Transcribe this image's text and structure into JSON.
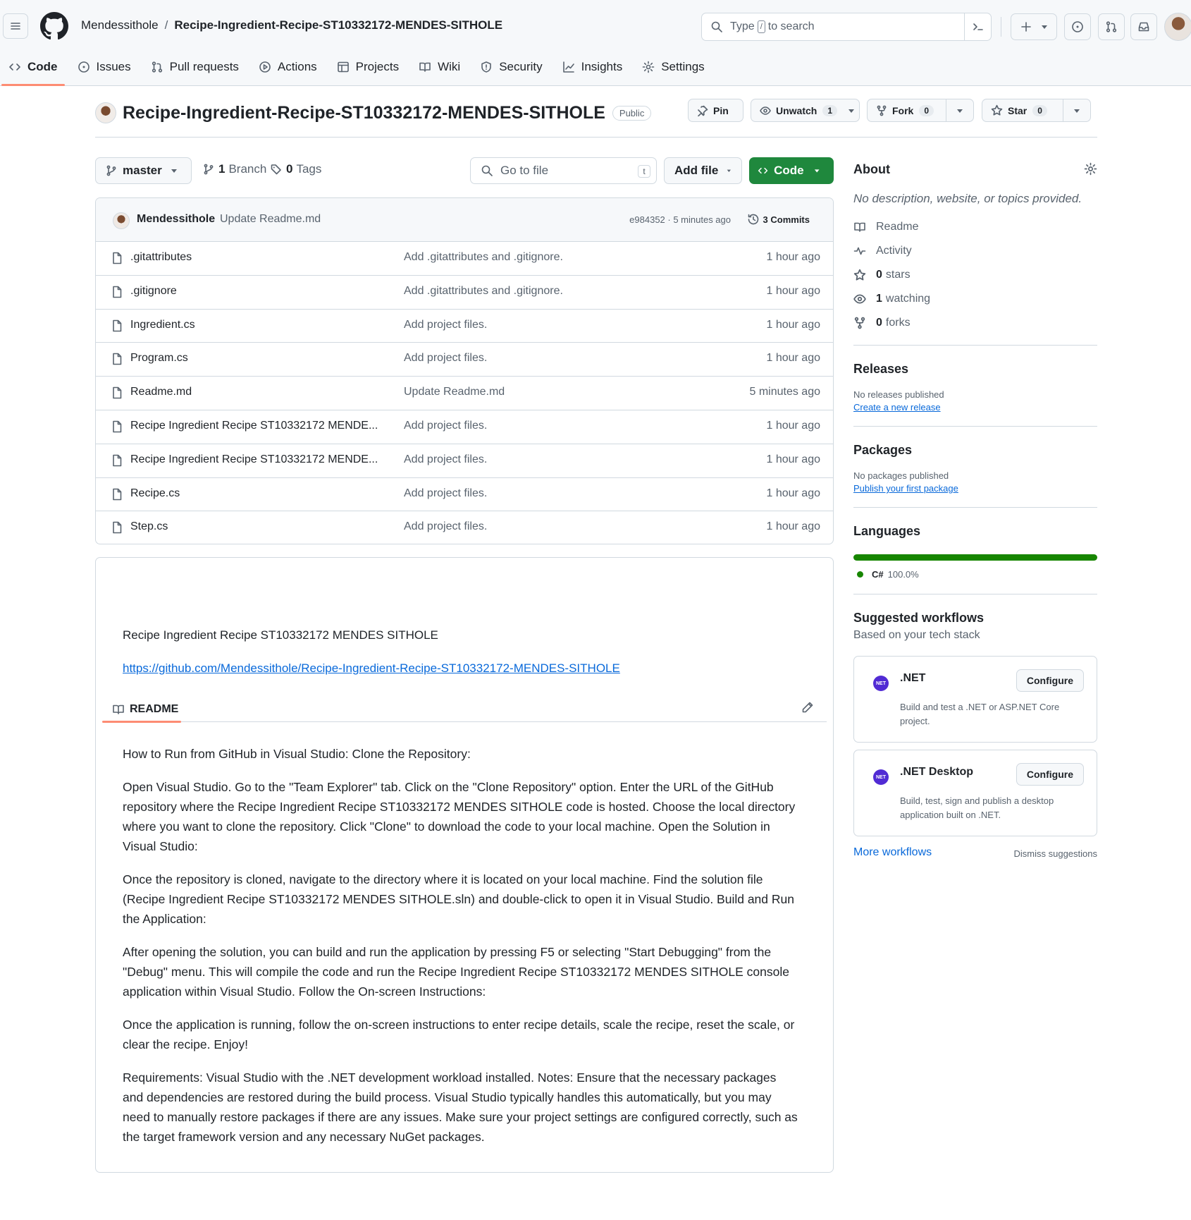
{
  "header": {
    "owner": "Mendessithole",
    "separator": "/",
    "repo": "Recipe-Ingredient-Recipe-ST10332172-MENDES-SITHOLE",
    "search": {
      "before": "Type",
      "key": "/",
      "after": "to search"
    }
  },
  "tabs": [
    {
      "label": "Code",
      "icon": "code-icon",
      "active": true
    },
    {
      "label": "Issues",
      "icon": "issue-icon"
    },
    {
      "label": "Pull requests",
      "icon": "pull-request-icon"
    },
    {
      "label": "Actions",
      "icon": "play-icon"
    },
    {
      "label": "Projects",
      "icon": "table-icon"
    },
    {
      "label": "Wiki",
      "icon": "book-icon"
    },
    {
      "label": "Security",
      "icon": "shield-icon"
    },
    {
      "label": "Insights",
      "icon": "graph-icon"
    },
    {
      "label": "Settings",
      "icon": "gear-icon"
    }
  ],
  "repo_header": {
    "title": "Recipe-Ingredient-Recipe-ST10332172-MENDES-SITHOLE",
    "visibility": "Public",
    "pin": "Pin",
    "unwatch": "Unwatch",
    "watch_count": "1",
    "fork": "Fork",
    "fork_count": "0",
    "star": "Star",
    "star_count": "0"
  },
  "toolbar": {
    "branch": "master",
    "branches_count": "1",
    "branches_label": "Branch",
    "tags_count": "0",
    "tags_label": "Tags",
    "goto_placeholder": "Go to file",
    "goto_key": "t",
    "add_file": "Add file",
    "code": "Code"
  },
  "latest_commit": {
    "author": "Mendessithole",
    "message": "Update Readme.md",
    "meta": "e984352 · 5 minutes ago",
    "commits": "3 Commits"
  },
  "files": [
    {
      "name": ".gitattributes",
      "message": "Add .gitattributes and .gitignore.",
      "age": "1 hour ago"
    },
    {
      "name": ".gitignore",
      "message": "Add .gitattributes and .gitignore.",
      "age": "1 hour ago"
    },
    {
      "name": "Ingredient.cs",
      "message": "Add project files.",
      "age": "1 hour ago"
    },
    {
      "name": "Program.cs",
      "message": "Add project files.",
      "age": "1 hour ago"
    },
    {
      "name": "Readme.md",
      "message": "Update Readme.md",
      "age": "5 minutes ago"
    },
    {
      "name": "Recipe Ingredient Recipe ST10332172 MENDE...",
      "message": "Add project files.",
      "age": "1 hour ago"
    },
    {
      "name": "Recipe Ingredient Recipe ST10332172 MENDE...",
      "message": "Add project files.",
      "age": "1 hour ago"
    },
    {
      "name": "Recipe.cs",
      "message": "Add project files.",
      "age": "1 hour ago"
    },
    {
      "name": "Step.cs",
      "message": "Add project files.",
      "age": "1 hour ago"
    }
  ],
  "readme": {
    "title_line": "Recipe Ingredient Recipe ST10332172 MENDES SITHOLE",
    "link": "https://github.com/Mendessithole/Recipe-Ingredient-Recipe-ST10332172-MENDES-SITHOLE",
    "tab_label": "README",
    "paragraphs": [
      "How to Run from GitHub in Visual Studio: Clone the Repository:",
      "Open Visual Studio. Go to the \"Team Explorer\" tab. Click on the \"Clone Repository\" option. Enter the URL of the GitHub repository where the Recipe Ingredient Recipe ST10332172 MENDES SITHOLE code is hosted. Choose the local directory where you want to clone the repository. Click \"Clone\" to download the code to your local machine. Open the Solution in Visual Studio:",
      "Once the repository is cloned, navigate to the directory where it is located on your local machine. Find the solution file (Recipe Ingredient Recipe ST10332172 MENDES SITHOLE.sln) and double-click to open it in Visual Studio. Build and Run the Application:",
      "After opening the solution, you can build and run the application by pressing F5 or selecting \"Start Debugging\" from the \"Debug\" menu. This will compile the code and run the Recipe Ingredient Recipe ST10332172 MENDES SITHOLE console application within Visual Studio. Follow the On-screen Instructions:",
      "Once the application is running, follow the on-screen instructions to enter recipe details, scale the recipe, reset the scale, or clear the recipe. Enjoy!",
      "Requirements: Visual Studio with the .NET development workload installed. Notes: Ensure that the necessary packages and dependencies are restored during the build process. Visual Studio typically handles this automatically, but you may need to manually restore packages if there are any issues. Make sure your project settings are configured correctly, such as the target framework version and any necessary NuGet packages."
    ]
  },
  "sidebar": {
    "about_title": "About",
    "about_desc": "No description, website, or topics provided.",
    "meta": [
      {
        "icon": "book-icon",
        "count": "",
        "label": "Readme"
      },
      {
        "icon": "pulse-icon",
        "count": "",
        "label": "Activity"
      },
      {
        "icon": "star-icon",
        "count": "0",
        "label": "stars"
      },
      {
        "icon": "eye-icon",
        "count": "1",
        "label": "watching"
      },
      {
        "icon": "fork-icon",
        "count": "0",
        "label": "forks"
      }
    ],
    "releases_title": "Releases",
    "releases_note": "No releases published",
    "releases_link": "Create a new release",
    "packages_title": "Packages",
    "packages_note": "No packages published",
    "packages_link": "Publish your first package",
    "languages_title": "Languages",
    "language": {
      "name": "C#",
      "percent": "100.0%",
      "color": "#178600"
    },
    "workflows_title": "Suggested workflows",
    "workflows_sub": "Based on your tech stack",
    "workflows": [
      {
        "logo": "NET",
        "name": ".NET",
        "configure": "Configure",
        "desc": "Build and test a .NET or ASP.NET Core project."
      },
      {
        "logo": "NET",
        "name": ".NET Desktop",
        "configure": "Configure",
        "desc": "Build, test, sign and publish a desktop application built on .NET."
      }
    ],
    "more_workflows": "More workflows",
    "dismiss": "Dismiss suggestions"
  },
  "colors": {
    "accent_tab": "#fd8c73",
    "primary_button": "#1f883d",
    "link": "#0969da",
    "csharp": "#178600"
  }
}
